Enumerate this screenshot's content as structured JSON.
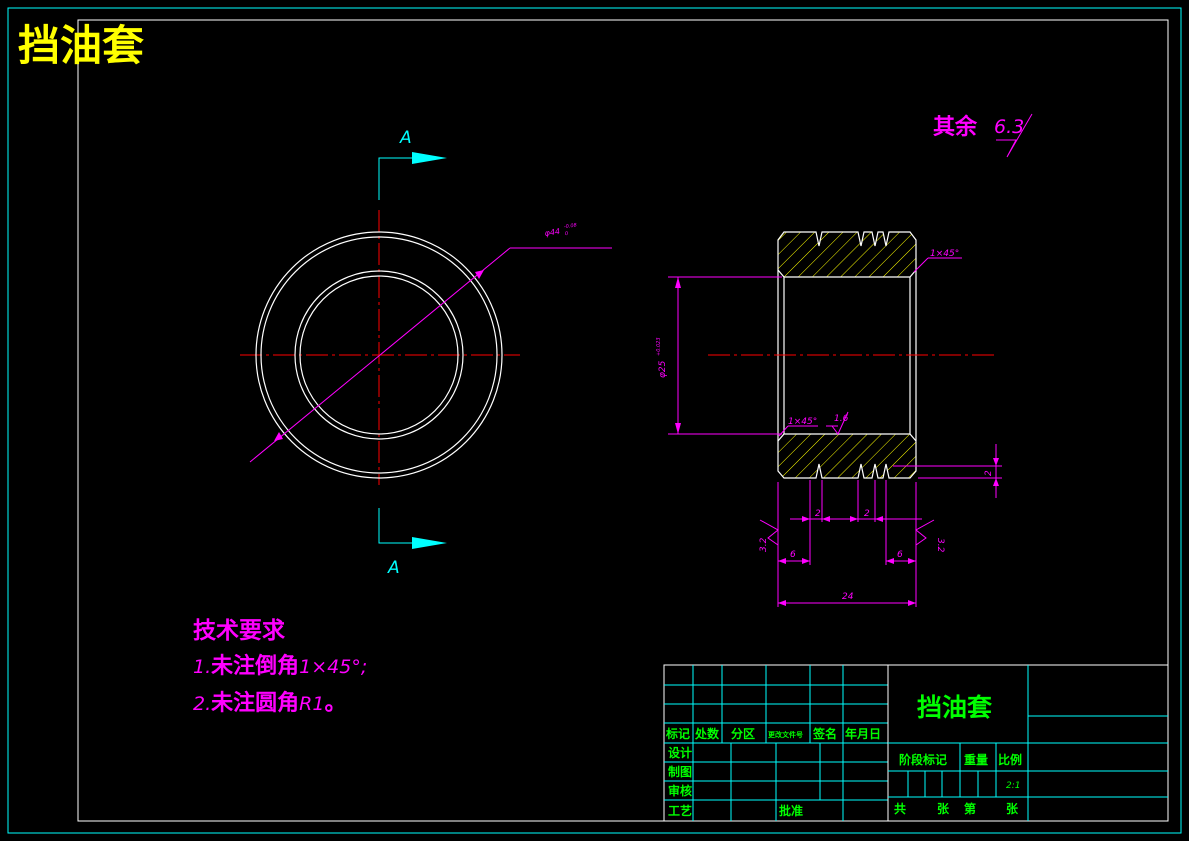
{
  "title_overlay": "挡油套",
  "view_label_top": "A",
  "view_label_bottom": "A",
  "roughness_note": {
    "prefix": "其余",
    "value": "6.3"
  },
  "dimensions": {
    "outer_diameter": "φ44",
    "outer_tol": "-0.08",
    "outer_tol_zero": "0",
    "inner_diameter": "φ25",
    "inner_tol": "+0.023",
    "chamfer_top": "1×45°",
    "chamfer_inner": "1×45°",
    "roughness_inner": "1.6",
    "groove_depth": "2",
    "groove_w1": "2",
    "groove_w2": "2",
    "left_offset": "6",
    "right_offset": "6",
    "total_length": "24",
    "rough_left": "3.2",
    "rough_right": "3.2"
  },
  "tech_req": {
    "heading": "技术要求",
    "item1_num": "1.",
    "item1_text": "未注倒角",
    "item1_val": "1×45°;",
    "item2_num": "2.",
    "item2_text": "未注圆角",
    "item2_val": "R1",
    "item2_end": "。"
  },
  "title_block": {
    "part_name": "挡油套",
    "hdr_mark": "标记",
    "hdr_count": "处数",
    "hdr_zone": "分区",
    "hdr_docno": "更改文件号",
    "hdr_sign": "签名",
    "hdr_date": "年月日",
    "design": "设计",
    "draw": "制图",
    "review": "审核",
    "process": "工艺",
    "approve": "批准",
    "stage": "阶段标记",
    "weight": "重量",
    "scale": "比例",
    "scale_val": "2:1",
    "sheet_total": "共",
    "sheet_zhang1": "张",
    "sheet_di": "第",
    "sheet_zhang2": "张"
  },
  "colors": {
    "background": "#000000",
    "border": "#00ffff",
    "outline": "#ffffff",
    "centerline": "#ff0000",
    "dimension": "#ff00ff",
    "hatch": "#ffff00",
    "title": "#ffff00",
    "title_block_text": "#00ff00",
    "section_arrow": "#00ffff"
  }
}
